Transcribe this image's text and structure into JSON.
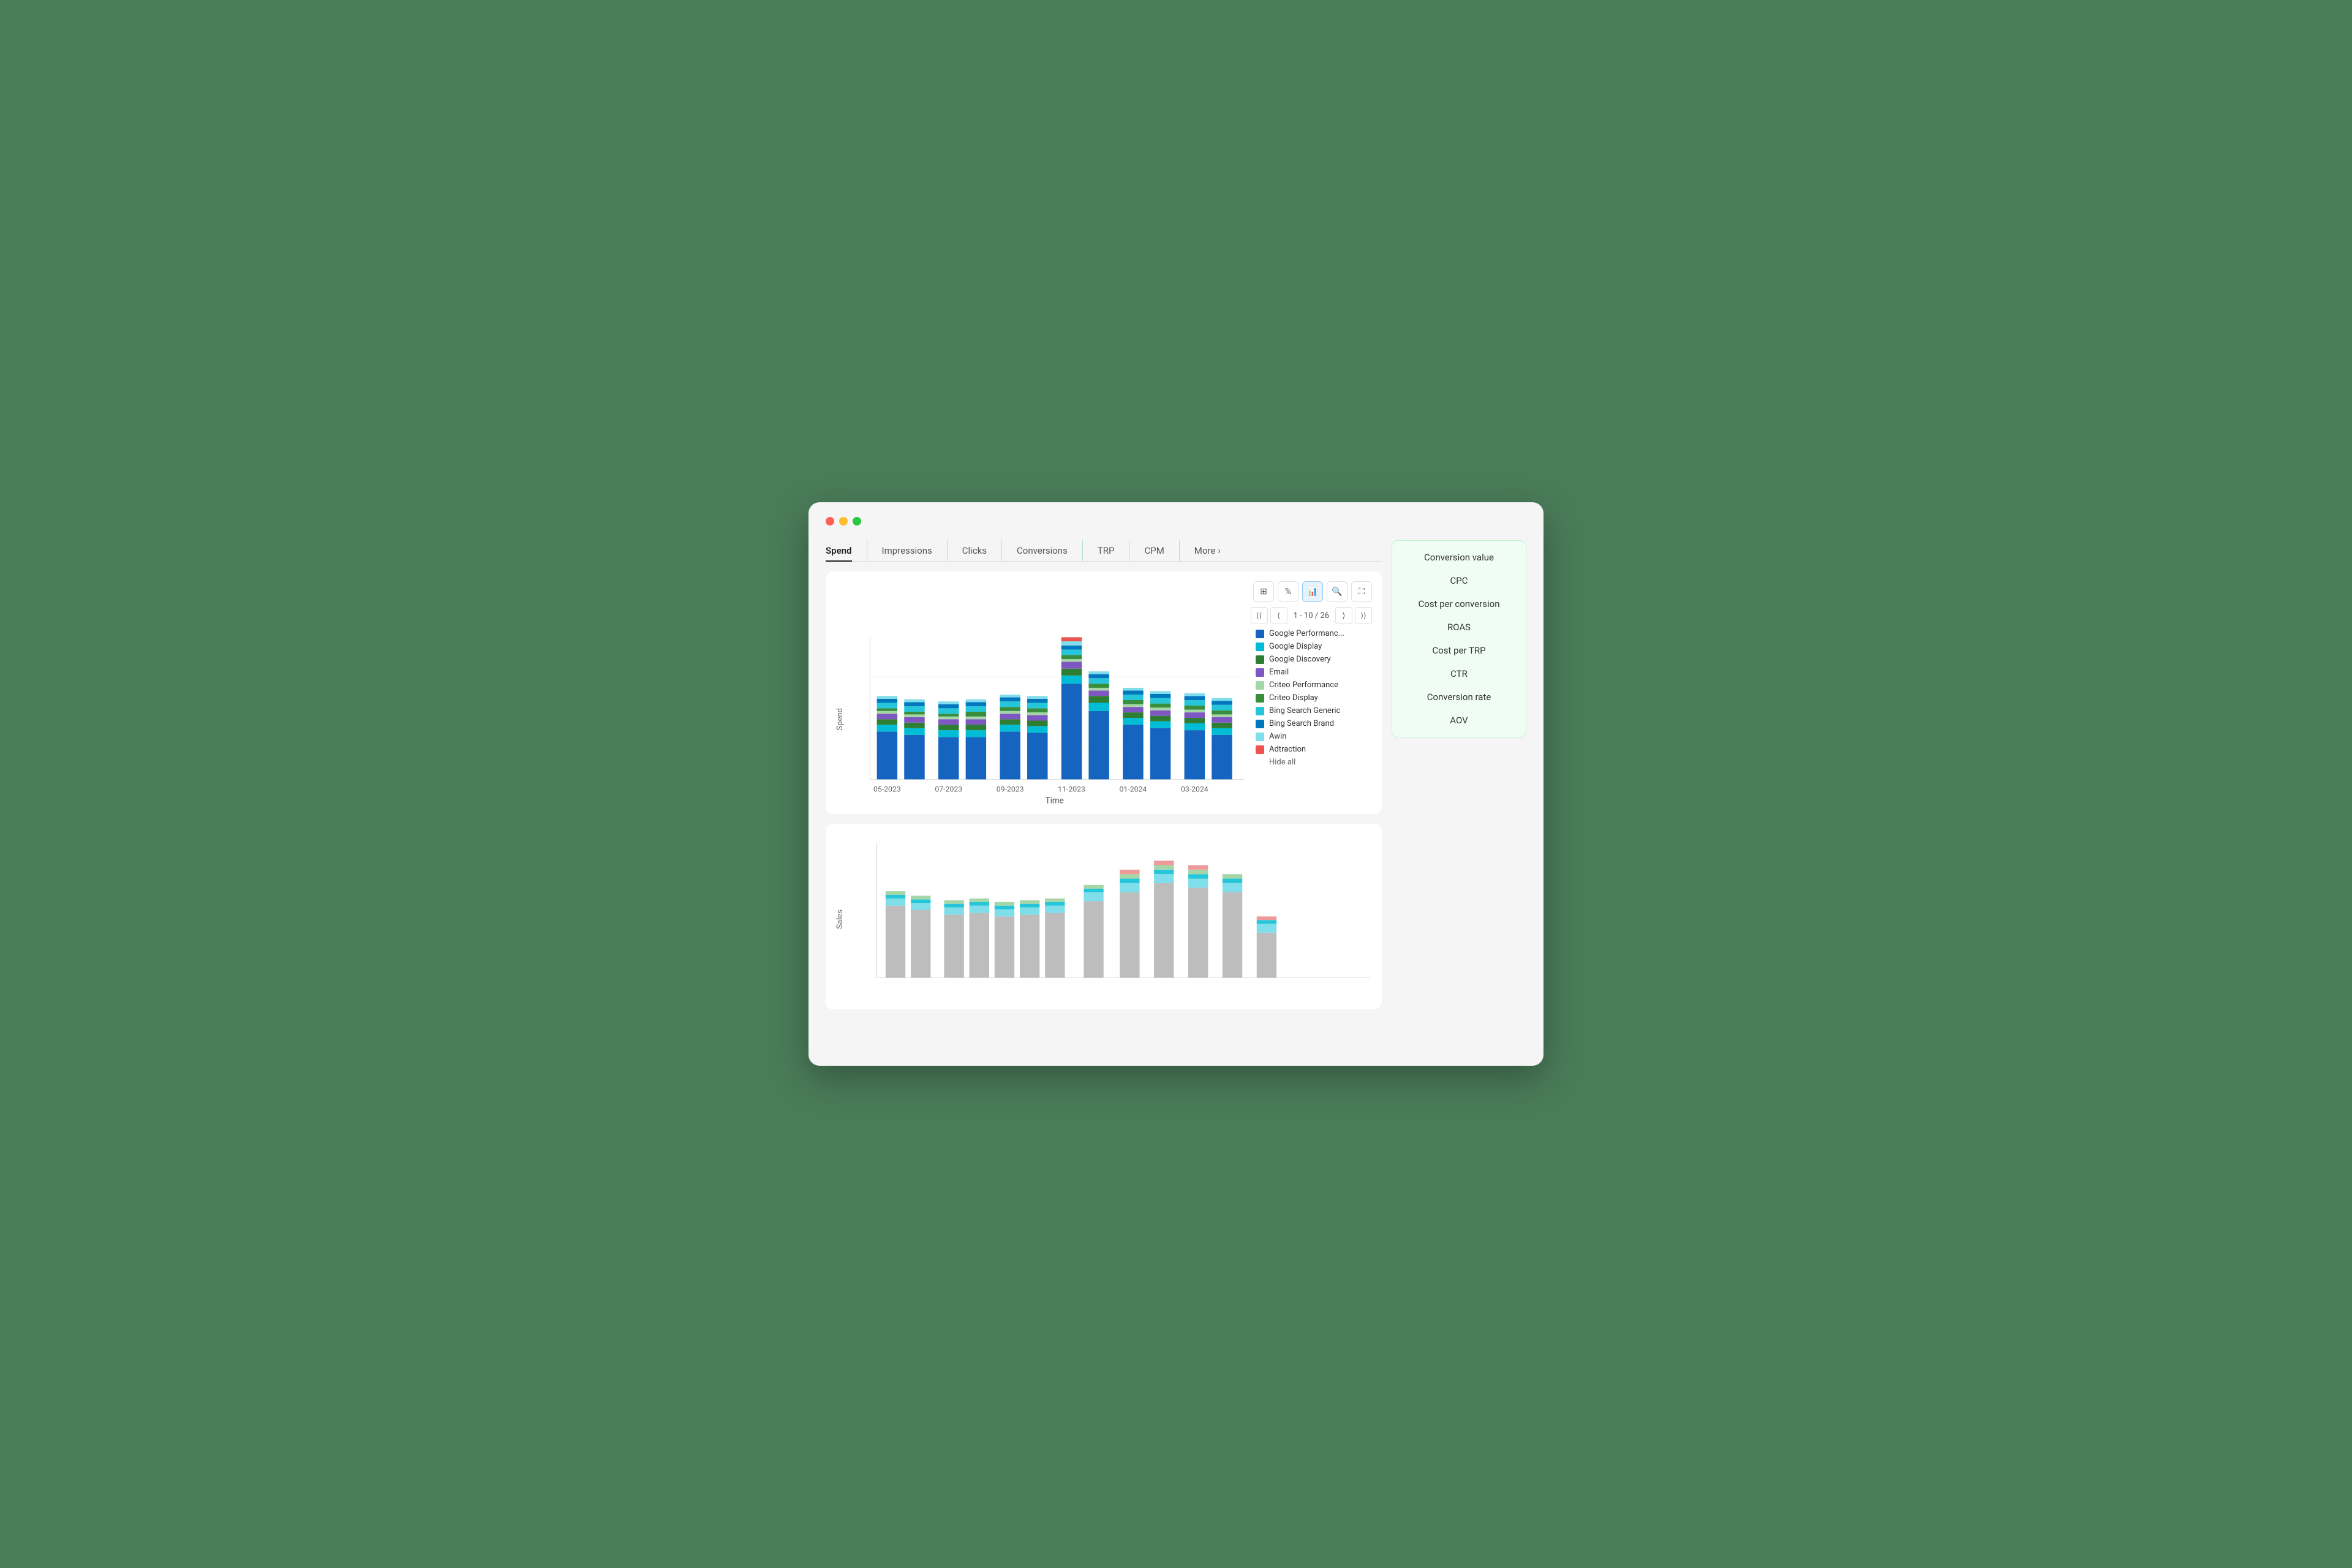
{
  "window": {
    "dots": [
      "red",
      "yellow",
      "green"
    ]
  },
  "tabs": {
    "items": [
      {
        "label": "Spend",
        "active": true
      },
      {
        "label": "Impressions",
        "active": false
      },
      {
        "label": "Clicks",
        "active": false
      },
      {
        "label": "Conversions",
        "active": false
      },
      {
        "label": "TRP",
        "active": false
      },
      {
        "label": "CPM",
        "active": false
      },
      {
        "label": "More",
        "active": false
      }
    ]
  },
  "toolbar": {
    "buttons": [
      {
        "icon": "⊞",
        "label": "table-view",
        "active": false
      },
      {
        "icon": "%",
        "label": "percent-view",
        "active": false
      },
      {
        "icon": "⬚",
        "label": "chart-view",
        "active": true
      },
      {
        "icon": "🔍",
        "label": "zoom-view",
        "active": false
      },
      {
        "icon": "⛶",
        "label": "fullscreen",
        "active": false
      }
    ]
  },
  "pagination": {
    "current": "1 - 10 / 26"
  },
  "chart": {
    "y_label": "Spend",
    "x_label": "Time",
    "x_ticks": [
      "05-2023",
      "07-2023",
      "09-2023",
      "11-2023",
      "01-2024",
      "03-2024"
    ]
  },
  "legend": {
    "items": [
      {
        "label": "Google Performanc...",
        "color": "#1565c0"
      },
      {
        "label": "Google Display",
        "color": "#00bcd4"
      },
      {
        "label": "Google Discovery",
        "color": "#2e7d32"
      },
      {
        "label": "Email",
        "color": "#7e57c2"
      },
      {
        "label": "Criteo Performance",
        "color": "#a5d6a7"
      },
      {
        "label": "Criteo Display",
        "color": "#388e3c"
      },
      {
        "label": "Bing Search Generic",
        "color": "#26c6da"
      },
      {
        "label": "Bing Search Brand",
        "color": "#0277bd"
      },
      {
        "label": "Awin",
        "color": "#80deea"
      },
      {
        "label": "Adtraction",
        "color": "#ef5350"
      }
    ],
    "hide_all": "Hide all"
  },
  "dropdown": {
    "items": [
      {
        "label": "Conversion value"
      },
      {
        "label": "CPC"
      },
      {
        "label": "Cost per conversion"
      },
      {
        "label": "ROAS"
      },
      {
        "label": "Cost per TRP"
      },
      {
        "label": "CTR"
      },
      {
        "label": "Conversion rate"
      },
      {
        "label": "AOV"
      }
    ]
  },
  "bottom_chart": {
    "y_label": "Sales"
  }
}
